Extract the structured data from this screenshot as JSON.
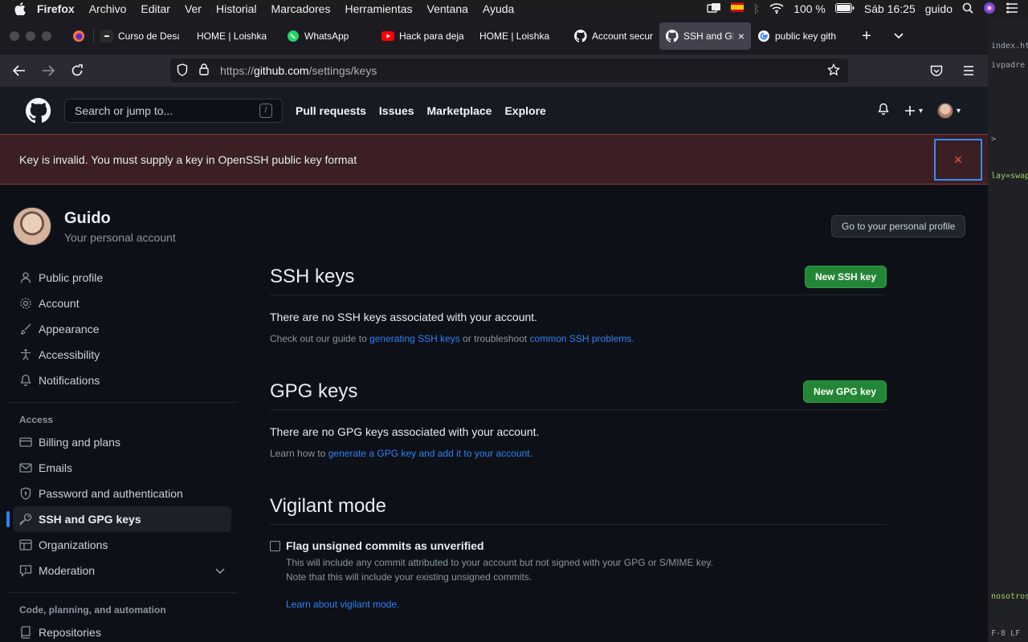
{
  "menubar": {
    "app": "Firefox",
    "items": [
      "Archivo",
      "Editar",
      "Ver",
      "Historial",
      "Marcadores",
      "Herramientas",
      "Ventana",
      "Ayuda"
    ],
    "battery": "100 %",
    "clock": "Sáb 16:25",
    "user": "guido"
  },
  "tabs": [
    {
      "label": "Curso de Desa",
      "icon": "course-favicon",
      "color": "#2b2b2b"
    },
    {
      "label": "HOME | Loishka",
      "icon": "none",
      "color": ""
    },
    {
      "label": "WhatsApp",
      "icon": "whatsapp-favicon",
      "color": "#25d366"
    },
    {
      "label": "Hack para deja",
      "icon": "youtube-favicon",
      "color": "#ff0000"
    },
    {
      "label": "HOME | Loishka",
      "icon": "none",
      "color": ""
    },
    {
      "label": "Account secur",
      "icon": "github-favicon",
      "color": "#ffffff"
    },
    {
      "label": "SSH and GP",
      "icon": "github-favicon",
      "color": "#ffffff",
      "active": true
    },
    {
      "label": "public key gith",
      "icon": "google-favicon",
      "color": "#4285f4"
    }
  ],
  "url": {
    "prefix": "https://",
    "host": "github.com",
    "path": "/settings/keys"
  },
  "header": {
    "search_placeholder": "Search or jump to...",
    "search_hotkey": "/",
    "nav": [
      "Pull requests",
      "Issues",
      "Marketplace",
      "Explore"
    ]
  },
  "flash": {
    "message": "Key is invalid. You must supply a key in OpenSSH public key format",
    "close": "×"
  },
  "profile": {
    "name": "Guido",
    "subtitle": "Your personal account",
    "button": "Go to your personal profile"
  },
  "sidebar": {
    "items": [
      {
        "label": "Public profile",
        "icon": "person-icon"
      },
      {
        "label": "Account",
        "icon": "gear-icon"
      },
      {
        "label": "Appearance",
        "icon": "paintbrush-icon"
      },
      {
        "label": "Accessibility",
        "icon": "accessibility-icon"
      },
      {
        "label": "Notifications",
        "icon": "bell-icon"
      }
    ],
    "access_heading": "Access",
    "access_items": [
      {
        "label": "Billing and plans",
        "icon": "credit-card-icon"
      },
      {
        "label": "Emails",
        "icon": "mail-icon"
      },
      {
        "label": "Password and authentication",
        "icon": "shield-lock-icon"
      },
      {
        "label": "SSH and GPG keys",
        "icon": "key-icon",
        "active": true
      },
      {
        "label": "Organizations",
        "icon": "table-icon"
      },
      {
        "label": "Moderation",
        "icon": "report-icon"
      }
    ],
    "code_heading": "Code, planning, and automation",
    "code_items": [
      {
        "label": "Repositories",
        "icon": "repo-icon"
      }
    ]
  },
  "ssh": {
    "title": "SSH keys",
    "button": "New SSH key",
    "empty": "There are no SSH keys associated with your account.",
    "help_prefix": "Check out our guide to ",
    "help_link1": "generating SSH keys",
    "help_middle": " or troubleshoot ",
    "help_link2": "common SSH problems",
    "help_suffix": "."
  },
  "gpg": {
    "title": "GPG keys",
    "button": "New GPG key",
    "empty": "There are no GPG keys associated with your account.",
    "help_prefix": "Learn how to ",
    "help_link": "generate a GPG key and add it to your account",
    "help_suffix": "."
  },
  "vigilant": {
    "title": "Vigilant mode",
    "checkbox_label": "Flag unsigned commits as unverified",
    "checked": false,
    "note1": "This will include any commit attributed to your account but not signed with your GPG or S/MIME key.",
    "note2": "Note that this will include your existing unsigned commits.",
    "link": "Learn about vigilant mode."
  },
  "peek": {
    "l1": "index.ht",
    "l2": "ivpadre >",
    "l3": ">",
    "l4": "lay=swap",
    "l5": "nosotros",
    "l6": "F-8   LF"
  },
  "colors": {
    "accent": "#2f81f7",
    "green_button": "#238636",
    "danger": "#f85149",
    "flash_bg": "#3b1f23"
  }
}
